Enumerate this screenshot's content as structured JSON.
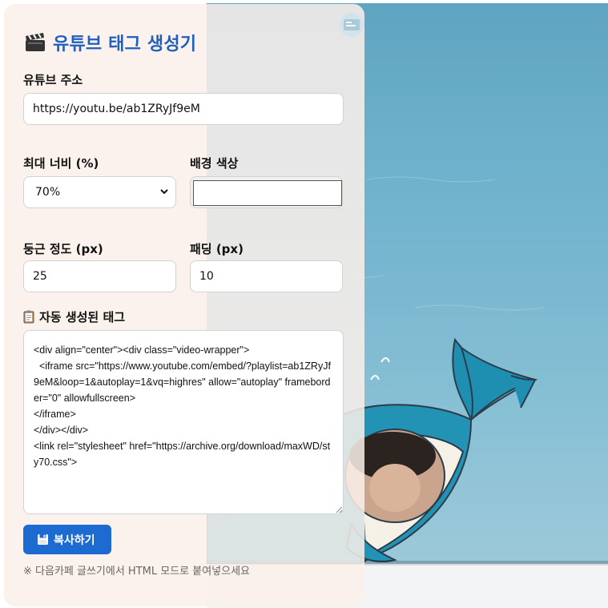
{
  "header": {
    "title": "유튜브 태그 생성기",
    "icon": "clapperboard-icon"
  },
  "form": {
    "url_label": "유튜브 주소",
    "url_value": "https://youtu.be/ab1ZRyJf9eM",
    "width_label": "최대 너비 (%)",
    "width_value": "70%",
    "bg_label": "배경 색상",
    "bg_value": "#ffffff",
    "radius_label": "둥근 정도 (px)",
    "radius_value": "25",
    "padding_label": "패딩 (px)",
    "padding_value": "10"
  },
  "output": {
    "label": "자동 생성된 태그",
    "icon": "clipboard-icon",
    "code": "<div align=\"center\"><div class=\"video-wrapper\">\n  <iframe src=\"https://www.youtube.com/embed/?playlist=ab1ZRyJf9eM&loop=1&autoplay=1&vq=highres\" allow=\"autoplay\" frameborder=\"0\" allowfullscreen>\n</iframe>\n</div></div>\n<link rel=\"stylesheet\" href=\"https://archive.org/download/maxWD/sty70.css\">"
  },
  "actions": {
    "copy_label": "복사하기",
    "copy_icon": "floppy-disk-icon"
  },
  "note": "※ 다음카페 글쓰기에서 HTML 모드로 붙여넣으세요",
  "colors": {
    "accent": "#1d6ad0",
    "title": "#1f5fbf",
    "panel_bg": "#faf0ea",
    "sea": "#6aaecb"
  }
}
